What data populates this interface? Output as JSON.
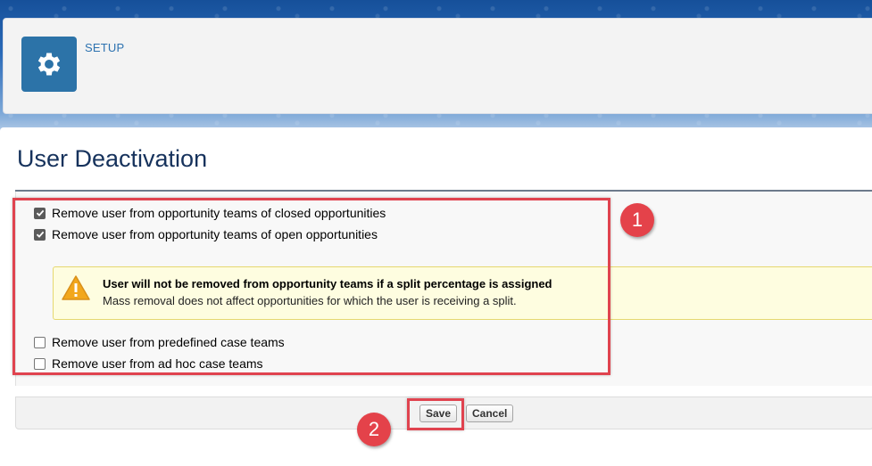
{
  "header": {
    "section_label": "SETUP",
    "icon": "gear-icon"
  },
  "page": {
    "title": "User Deactivation"
  },
  "options": [
    {
      "label": "Remove user from opportunity teams of closed opportunities",
      "checked": true
    },
    {
      "label": "Remove user from opportunity teams of open opportunities",
      "checked": true
    },
    {
      "label": "Remove user from predefined case teams",
      "checked": false
    },
    {
      "label": "Remove user from ad hoc case teams",
      "checked": false
    }
  ],
  "warning": {
    "icon": "warning-icon",
    "title": "User will not be removed from opportunity teams if a split percentage is assigned",
    "text": "Mass removal does not affect opportunities for which the user is receiving a split."
  },
  "buttons": {
    "save": "Save",
    "cancel": "Cancel"
  },
  "callouts": {
    "step1": "1",
    "step2": "2",
    "color": "#e0434f"
  }
}
